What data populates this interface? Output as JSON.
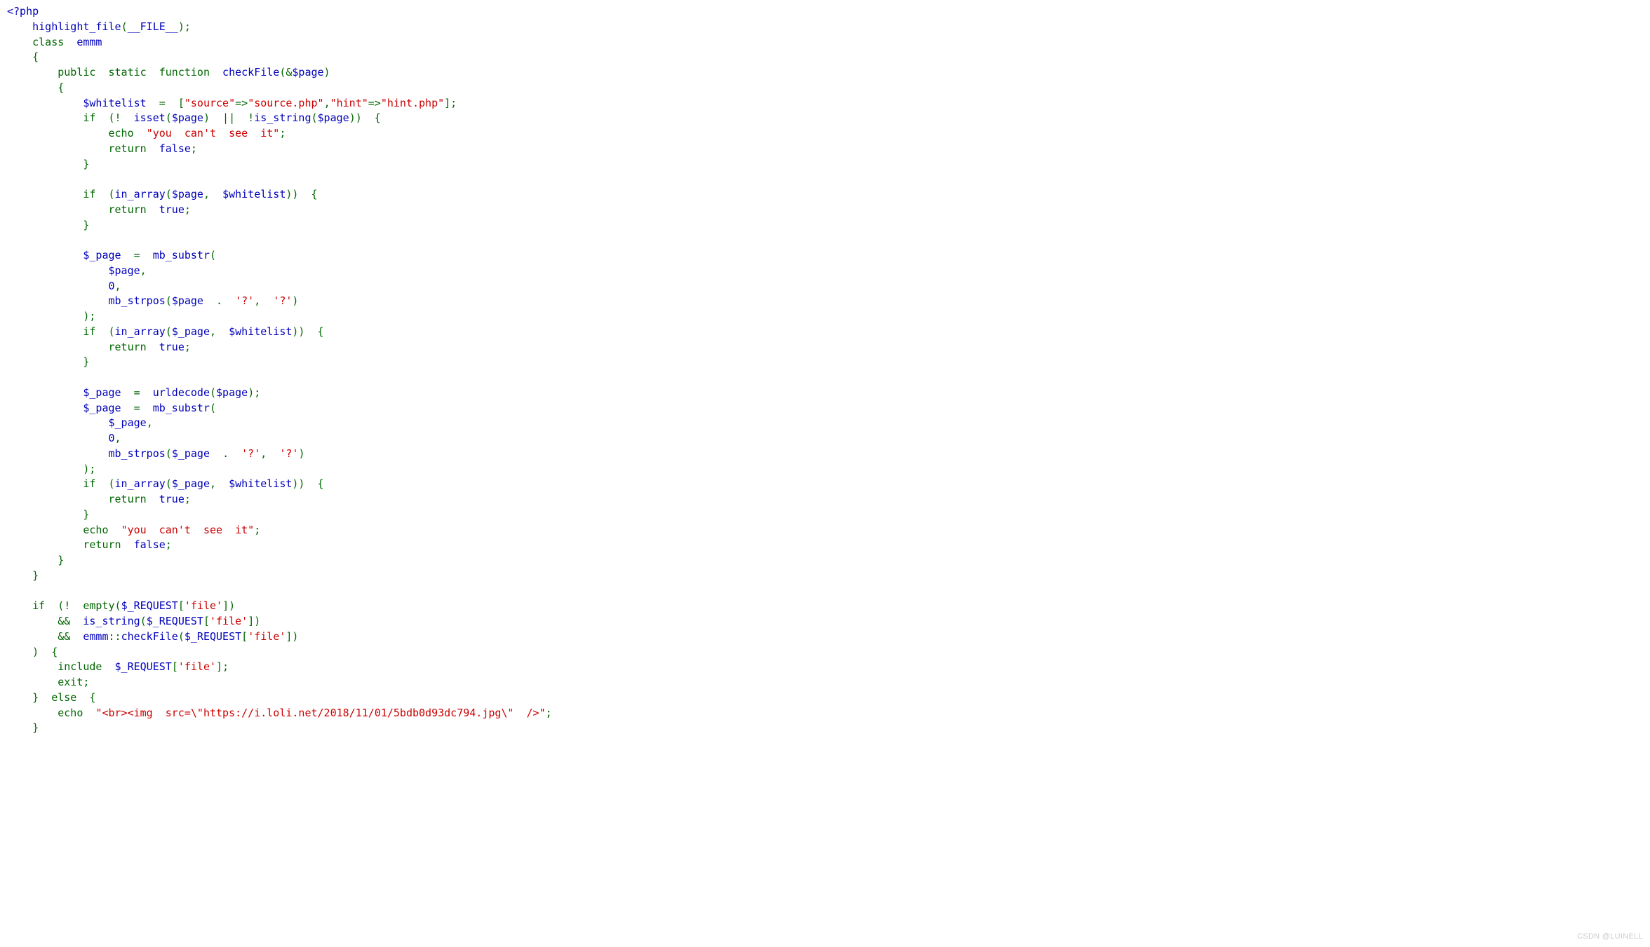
{
  "watermark": "CSDN @LUINELL",
  "tokens": [
    {
      "t": "<?php",
      "c": "builtin"
    },
    {
      "t": "\n",
      "c": "default"
    },
    {
      "t": "    ",
      "c": "default"
    },
    {
      "t": "highlight_file",
      "c": "builtin"
    },
    {
      "t": "(",
      "c": "punc"
    },
    {
      "t": "__FILE__",
      "c": "builtin"
    },
    {
      "t": ");",
      "c": "punc"
    },
    {
      "t": "\n",
      "c": "default"
    },
    {
      "t": "    class  ",
      "c": "punc"
    },
    {
      "t": "emmm",
      "c": "builtin"
    },
    {
      "t": "\n",
      "c": "default"
    },
    {
      "t": "    ",
      "c": "default"
    },
    {
      "t": "{",
      "c": "punc"
    },
    {
      "t": "\n",
      "c": "default"
    },
    {
      "t": "        public  static  function  ",
      "c": "punc"
    },
    {
      "t": "checkFile",
      "c": "builtin"
    },
    {
      "t": "(&",
      "c": "punc"
    },
    {
      "t": "$page",
      "c": "builtin"
    },
    {
      "t": ")",
      "c": "punc"
    },
    {
      "t": "\n",
      "c": "default"
    },
    {
      "t": "        ",
      "c": "default"
    },
    {
      "t": "{",
      "c": "punc"
    },
    {
      "t": "\n",
      "c": "default"
    },
    {
      "t": "            ",
      "c": "default"
    },
    {
      "t": "$whitelist  ",
      "c": "builtin"
    },
    {
      "t": "=  [",
      "c": "punc"
    },
    {
      "t": "\"source\"",
      "c": "string"
    },
    {
      "t": "=>",
      "c": "punc"
    },
    {
      "t": "\"source.php\"",
      "c": "string"
    },
    {
      "t": ",",
      "c": "punc"
    },
    {
      "t": "\"hint\"",
      "c": "string"
    },
    {
      "t": "=>",
      "c": "punc"
    },
    {
      "t": "\"hint.php\"",
      "c": "string"
    },
    {
      "t": "];",
      "c": "punc"
    },
    {
      "t": "\n",
      "c": "default"
    },
    {
      "t": "            if  (!  ",
      "c": "punc"
    },
    {
      "t": "isset",
      "c": "builtin"
    },
    {
      "t": "(",
      "c": "punc"
    },
    {
      "t": "$page",
      "c": "builtin"
    },
    {
      "t": ")  ||  !",
      "c": "punc"
    },
    {
      "t": "is_string",
      "c": "builtin"
    },
    {
      "t": "(",
      "c": "punc"
    },
    {
      "t": "$page",
      "c": "builtin"
    },
    {
      "t": "))  {",
      "c": "punc"
    },
    {
      "t": "\n",
      "c": "default"
    },
    {
      "t": "                echo  ",
      "c": "punc"
    },
    {
      "t": "\"you  can't  see  it\"",
      "c": "string"
    },
    {
      "t": ";",
      "c": "punc"
    },
    {
      "t": "\n",
      "c": "default"
    },
    {
      "t": "                return  ",
      "c": "punc"
    },
    {
      "t": "false",
      "c": "builtin"
    },
    {
      "t": ";",
      "c": "punc"
    },
    {
      "t": "\n",
      "c": "default"
    },
    {
      "t": "            ",
      "c": "default"
    },
    {
      "t": "}",
      "c": "punc"
    },
    {
      "t": "\n",
      "c": "default"
    },
    {
      "t": "\n",
      "c": "default"
    },
    {
      "t": "            if  (",
      "c": "punc"
    },
    {
      "t": "in_array",
      "c": "builtin"
    },
    {
      "t": "(",
      "c": "punc"
    },
    {
      "t": "$page",
      "c": "builtin"
    },
    {
      "t": ",  ",
      "c": "punc"
    },
    {
      "t": "$whitelist",
      "c": "builtin"
    },
    {
      "t": "))  {",
      "c": "punc"
    },
    {
      "t": "\n",
      "c": "default"
    },
    {
      "t": "                return  ",
      "c": "punc"
    },
    {
      "t": "true",
      "c": "builtin"
    },
    {
      "t": ";",
      "c": "punc"
    },
    {
      "t": "\n",
      "c": "default"
    },
    {
      "t": "            ",
      "c": "default"
    },
    {
      "t": "}",
      "c": "punc"
    },
    {
      "t": "\n",
      "c": "default"
    },
    {
      "t": "\n",
      "c": "default"
    },
    {
      "t": "            ",
      "c": "default"
    },
    {
      "t": "$_page  ",
      "c": "builtin"
    },
    {
      "t": "=  ",
      "c": "punc"
    },
    {
      "t": "mb_substr",
      "c": "builtin"
    },
    {
      "t": "(",
      "c": "punc"
    },
    {
      "t": "\n",
      "c": "default"
    },
    {
      "t": "                ",
      "c": "default"
    },
    {
      "t": "$page",
      "c": "builtin"
    },
    {
      "t": ",",
      "c": "punc"
    },
    {
      "t": "\n",
      "c": "default"
    },
    {
      "t": "                ",
      "c": "default"
    },
    {
      "t": "0",
      "c": "builtin"
    },
    {
      "t": ",",
      "c": "punc"
    },
    {
      "t": "\n",
      "c": "default"
    },
    {
      "t": "                ",
      "c": "default"
    },
    {
      "t": "mb_strpos",
      "c": "builtin"
    },
    {
      "t": "(",
      "c": "punc"
    },
    {
      "t": "$page  ",
      "c": "builtin"
    },
    {
      "t": ".  ",
      "c": "punc"
    },
    {
      "t": "'?'",
      "c": "string"
    },
    {
      "t": ",  ",
      "c": "punc"
    },
    {
      "t": "'?'",
      "c": "string"
    },
    {
      "t": ")",
      "c": "punc"
    },
    {
      "t": "\n",
      "c": "default"
    },
    {
      "t": "            );",
      "c": "punc"
    },
    {
      "t": "\n",
      "c": "default"
    },
    {
      "t": "            if  (",
      "c": "punc"
    },
    {
      "t": "in_array",
      "c": "builtin"
    },
    {
      "t": "(",
      "c": "punc"
    },
    {
      "t": "$_page",
      "c": "builtin"
    },
    {
      "t": ",  ",
      "c": "punc"
    },
    {
      "t": "$whitelist",
      "c": "builtin"
    },
    {
      "t": "))  {",
      "c": "punc"
    },
    {
      "t": "\n",
      "c": "default"
    },
    {
      "t": "                return  ",
      "c": "punc"
    },
    {
      "t": "true",
      "c": "builtin"
    },
    {
      "t": ";",
      "c": "punc"
    },
    {
      "t": "\n",
      "c": "default"
    },
    {
      "t": "            ",
      "c": "default"
    },
    {
      "t": "}",
      "c": "punc"
    },
    {
      "t": "\n",
      "c": "default"
    },
    {
      "t": "\n",
      "c": "default"
    },
    {
      "t": "            ",
      "c": "default"
    },
    {
      "t": "$_page  ",
      "c": "builtin"
    },
    {
      "t": "=  ",
      "c": "punc"
    },
    {
      "t": "urldecode",
      "c": "builtin"
    },
    {
      "t": "(",
      "c": "punc"
    },
    {
      "t": "$page",
      "c": "builtin"
    },
    {
      "t": ");",
      "c": "punc"
    },
    {
      "t": "\n",
      "c": "default"
    },
    {
      "t": "            ",
      "c": "default"
    },
    {
      "t": "$_page  ",
      "c": "builtin"
    },
    {
      "t": "=  ",
      "c": "punc"
    },
    {
      "t": "mb_substr",
      "c": "builtin"
    },
    {
      "t": "(",
      "c": "punc"
    },
    {
      "t": "\n",
      "c": "default"
    },
    {
      "t": "                ",
      "c": "default"
    },
    {
      "t": "$_page",
      "c": "builtin"
    },
    {
      "t": ",",
      "c": "punc"
    },
    {
      "t": "\n",
      "c": "default"
    },
    {
      "t": "                ",
      "c": "default"
    },
    {
      "t": "0",
      "c": "builtin"
    },
    {
      "t": ",",
      "c": "punc"
    },
    {
      "t": "\n",
      "c": "default"
    },
    {
      "t": "                ",
      "c": "default"
    },
    {
      "t": "mb_strpos",
      "c": "builtin"
    },
    {
      "t": "(",
      "c": "punc"
    },
    {
      "t": "$_page  ",
      "c": "builtin"
    },
    {
      "t": ".  ",
      "c": "punc"
    },
    {
      "t": "'?'",
      "c": "string"
    },
    {
      "t": ",  ",
      "c": "punc"
    },
    {
      "t": "'?'",
      "c": "string"
    },
    {
      "t": ")",
      "c": "punc"
    },
    {
      "t": "\n",
      "c": "default"
    },
    {
      "t": "            );",
      "c": "punc"
    },
    {
      "t": "\n",
      "c": "default"
    },
    {
      "t": "            if  (",
      "c": "punc"
    },
    {
      "t": "in_array",
      "c": "builtin"
    },
    {
      "t": "(",
      "c": "punc"
    },
    {
      "t": "$_page",
      "c": "builtin"
    },
    {
      "t": ",  ",
      "c": "punc"
    },
    {
      "t": "$whitelist",
      "c": "builtin"
    },
    {
      "t": "))  {",
      "c": "punc"
    },
    {
      "t": "\n",
      "c": "default"
    },
    {
      "t": "                return  ",
      "c": "punc"
    },
    {
      "t": "true",
      "c": "builtin"
    },
    {
      "t": ";",
      "c": "punc"
    },
    {
      "t": "\n",
      "c": "default"
    },
    {
      "t": "            ",
      "c": "default"
    },
    {
      "t": "}",
      "c": "punc"
    },
    {
      "t": "\n",
      "c": "default"
    },
    {
      "t": "            echo  ",
      "c": "punc"
    },
    {
      "t": "\"you  can't  see  it\"",
      "c": "string"
    },
    {
      "t": ";",
      "c": "punc"
    },
    {
      "t": "\n",
      "c": "default"
    },
    {
      "t": "            return  ",
      "c": "punc"
    },
    {
      "t": "false",
      "c": "builtin"
    },
    {
      "t": ";",
      "c": "punc"
    },
    {
      "t": "\n",
      "c": "default"
    },
    {
      "t": "        ",
      "c": "default"
    },
    {
      "t": "}",
      "c": "punc"
    },
    {
      "t": "\n",
      "c": "default"
    },
    {
      "t": "    ",
      "c": "default"
    },
    {
      "t": "}",
      "c": "punc"
    },
    {
      "t": "\n",
      "c": "default"
    },
    {
      "t": "\n",
      "c": "default"
    },
    {
      "t": "    if  (!  empty(",
      "c": "punc"
    },
    {
      "t": "$_REQUEST",
      "c": "builtin"
    },
    {
      "t": "[",
      "c": "punc"
    },
    {
      "t": "'file'",
      "c": "string"
    },
    {
      "t": "])",
      "c": "punc"
    },
    {
      "t": "\n",
      "c": "default"
    },
    {
      "t": "        &&  ",
      "c": "punc"
    },
    {
      "t": "is_string",
      "c": "builtin"
    },
    {
      "t": "(",
      "c": "punc"
    },
    {
      "t": "$_REQUEST",
      "c": "builtin"
    },
    {
      "t": "[",
      "c": "punc"
    },
    {
      "t": "'file'",
      "c": "string"
    },
    {
      "t": "])",
      "c": "punc"
    },
    {
      "t": "\n",
      "c": "default"
    },
    {
      "t": "        &&  ",
      "c": "punc"
    },
    {
      "t": "emmm",
      "c": "builtin"
    },
    {
      "t": "::",
      "c": "punc"
    },
    {
      "t": "checkFile",
      "c": "builtin"
    },
    {
      "t": "(",
      "c": "punc"
    },
    {
      "t": "$_REQUEST",
      "c": "builtin"
    },
    {
      "t": "[",
      "c": "punc"
    },
    {
      "t": "'file'",
      "c": "string"
    },
    {
      "t": "])",
      "c": "punc"
    },
    {
      "t": "\n",
      "c": "default"
    },
    {
      "t": "    )  {",
      "c": "punc"
    },
    {
      "t": "\n",
      "c": "default"
    },
    {
      "t": "        include  ",
      "c": "punc"
    },
    {
      "t": "$_REQUEST",
      "c": "builtin"
    },
    {
      "t": "[",
      "c": "punc"
    },
    {
      "t": "'file'",
      "c": "string"
    },
    {
      "t": "];",
      "c": "punc"
    },
    {
      "t": "\n",
      "c": "default"
    },
    {
      "t": "        exit;",
      "c": "punc"
    },
    {
      "t": "\n",
      "c": "default"
    },
    {
      "t": "    }  else  {",
      "c": "punc"
    },
    {
      "t": "\n",
      "c": "default"
    },
    {
      "t": "        echo  ",
      "c": "punc"
    },
    {
      "t": "\"<br><img  src=\\\"https://i.loli.net/2018/11/01/5bdb0d93dc794.jpg\\\"  />\"",
      "c": "string"
    },
    {
      "t": ";",
      "c": "punc"
    },
    {
      "t": "\n",
      "c": "default"
    },
    {
      "t": "    ",
      "c": "default"
    },
    {
      "t": "}",
      "c": "punc"
    }
  ]
}
